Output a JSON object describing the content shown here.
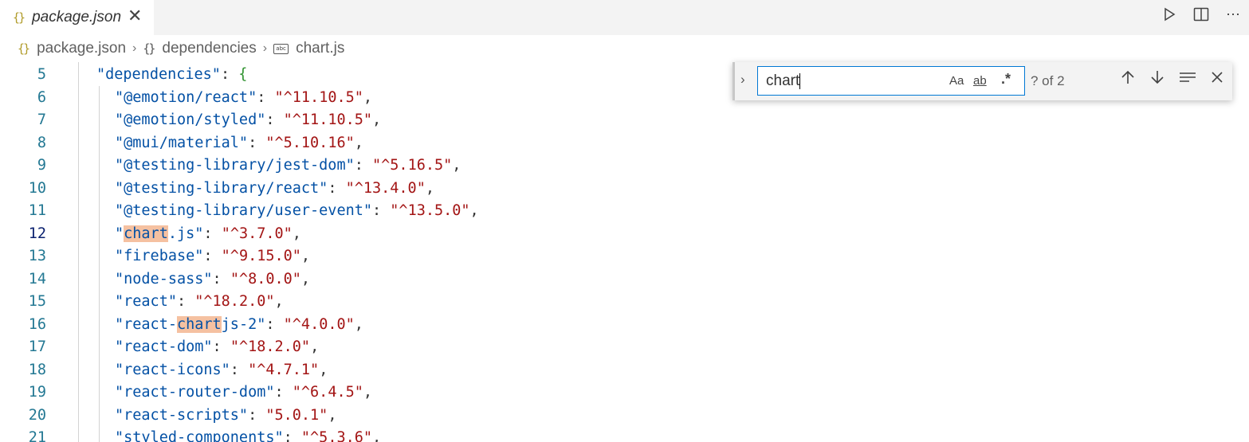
{
  "tab": {
    "label": "package.json",
    "icon": "{}"
  },
  "breadcrumb": {
    "items": [
      {
        "label": "package.json",
        "icon": "{}"
      },
      {
        "label": "dependencies",
        "icon": "{}"
      },
      {
        "label": "chart.js",
        "icon": "abc"
      }
    ]
  },
  "find": {
    "value": "chart",
    "match_case_label": "Aa",
    "whole_word_label": "ab",
    "regex_label": ".*",
    "matches": "? of 2"
  },
  "editor": {
    "lines": [
      {
        "n": "5",
        "key": "\"dependencies\"",
        "sep": ": ",
        "val": "{"
      },
      {
        "n": "6",
        "key": "\"@emotion/react\"",
        "sep": ": ",
        "val": "\"^11.10.5\"",
        "end": ","
      },
      {
        "n": "7",
        "key": "\"@emotion/styled\"",
        "sep": ": ",
        "val": "\"^11.10.5\"",
        "end": ","
      },
      {
        "n": "8",
        "key": "\"@mui/material\"",
        "sep": ": ",
        "val": "\"^5.10.16\"",
        "end": ","
      },
      {
        "n": "9",
        "key": "\"@testing-library/jest-dom\"",
        "sep": ": ",
        "val": "\"^5.16.5\"",
        "end": ","
      },
      {
        "n": "10",
        "key": "\"@testing-library/react\"",
        "sep": ": ",
        "val": "\"^13.4.0\"",
        "end": ","
      },
      {
        "n": "11",
        "key": "\"@testing-library/user-event\"",
        "sep": ": ",
        "val": "\"^13.5.0\"",
        "end": ","
      },
      {
        "n": "12",
        "key_pre": "\"",
        "key_hl": "chart",
        "key_post": ".js\"",
        "sep": ": ",
        "val": "\"^3.7.0\"",
        "end": ","
      },
      {
        "n": "13",
        "key": "\"firebase\"",
        "sep": ": ",
        "val": "\"^9.15.0\"",
        "end": ","
      },
      {
        "n": "14",
        "key": "\"node-sass\"",
        "sep": ": ",
        "val": "\"^8.0.0\"",
        "end": ","
      },
      {
        "n": "15",
        "key": "\"react\"",
        "sep": ": ",
        "val": "\"^18.2.0\"",
        "end": ","
      },
      {
        "n": "16",
        "key_pre": "\"react-",
        "key_hl": "chart",
        "key_post": "js-2\"",
        "sep": ": ",
        "val": "\"^4.0.0\"",
        "end": ","
      },
      {
        "n": "17",
        "key": "\"react-dom\"",
        "sep": ": ",
        "val": "\"^18.2.0\"",
        "end": ","
      },
      {
        "n": "18",
        "key": "\"react-icons\"",
        "sep": ": ",
        "val": "\"^4.7.1\"",
        "end": ","
      },
      {
        "n": "19",
        "key": "\"react-router-dom\"",
        "sep": ": ",
        "val": "\"^6.4.5\"",
        "end": ","
      },
      {
        "n": "20",
        "key": "\"react-scripts\"",
        "sep": ": ",
        "val": "\"5.0.1\"",
        "end": ","
      },
      {
        "n": "21",
        "key": "\"styled-components\"",
        "sep": ": ",
        "val": "\"^5.3.6\"",
        "end": ","
      }
    ]
  },
  "colors": {
    "key": "#0451a5",
    "string": "#a31515",
    "highlight": "#f5c1a1",
    "line_number": "#237893",
    "accent": "#0078d4"
  }
}
